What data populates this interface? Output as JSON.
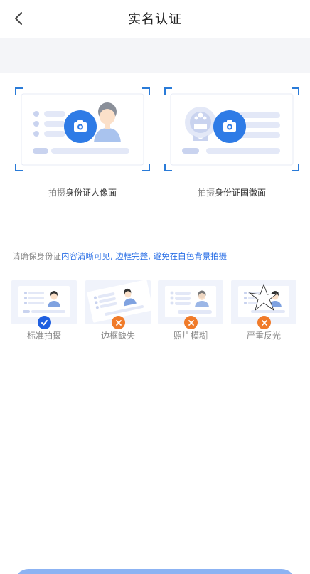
{
  "header": {
    "title": "实名认证"
  },
  "cards": [
    {
      "prefix": "拍摄",
      "bold": "身份证人像面"
    },
    {
      "prefix": "拍摄",
      "bold": "身份证国徽面"
    }
  ],
  "notice": {
    "prefix": "请确保身份证",
    "highlight": "内容清晰可见, 边框完整, 避免在白色背景拍摄"
  },
  "samples": [
    {
      "label": "标准拍摄",
      "status": "ok"
    },
    {
      "label": "边框缺失",
      "status": "bad"
    },
    {
      "label": "照片模糊",
      "status": "bad"
    },
    {
      "label": "严重反光",
      "status": "bad"
    }
  ],
  "colors": {
    "accent": "#2a6fe6",
    "corner": "#2a7bd8",
    "error": "#f07b2a",
    "ok": "#1f5fe0"
  }
}
